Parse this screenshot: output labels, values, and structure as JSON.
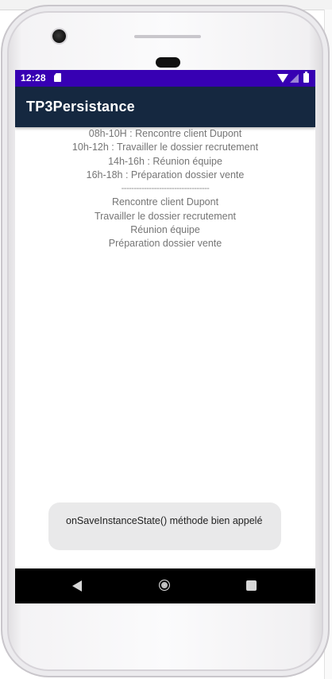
{
  "status_bar": {
    "time": "12:28"
  },
  "app_bar": {
    "title": "TP3Persistance"
  },
  "schedule": [
    "08h-10H : Rencontre client Dupont",
    "10h-12h : Travailler le dossier recrutement",
    "14h-16h : Réunion équipe",
    "16h-18h : Préparation dossier vente"
  ],
  "separator": "-----------------------------------",
  "tasks": [
    "Rencontre client Dupont",
    "Travailler le dossier recrutement",
    "Réunion équipe",
    "Préparation dossier vente"
  ],
  "toast": {
    "message": "onSaveInstanceState() méthode bien appelé"
  },
  "icons": {
    "status": [
      "sd-card-icon",
      "wifi-icon",
      "signal-icon",
      "battery-icon"
    ],
    "nav": [
      "back-icon",
      "home-icon",
      "recents-icon"
    ]
  },
  "colors": {
    "status_bar": "#3700b3",
    "app_bar": "#152840",
    "nav_bar": "#000000",
    "toast_bg": "#e9e9ea"
  }
}
